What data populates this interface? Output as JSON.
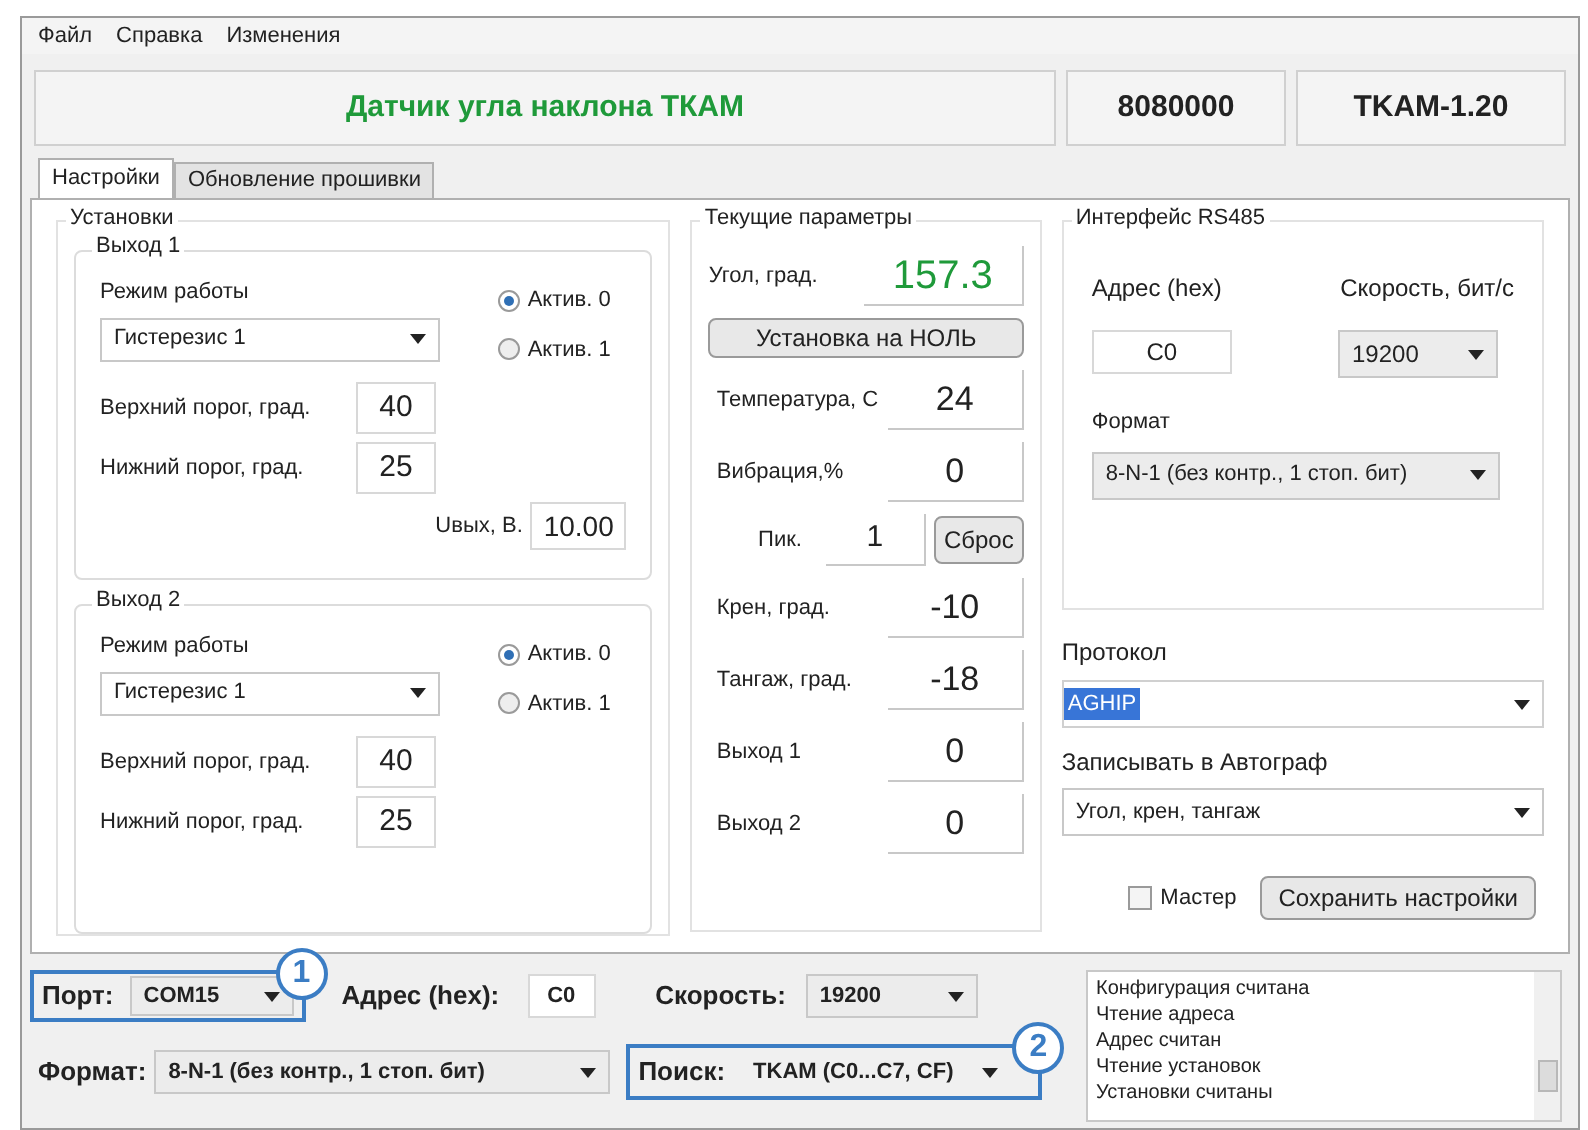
{
  "menu": [
    {
      "label": "Файл"
    },
    {
      "label": "Справка"
    },
    {
      "label": "Изменения"
    }
  ],
  "header": {
    "title": "Датчик угла наклона ТКАМ",
    "serial": "8080000",
    "version": "TKAM-1.20"
  },
  "tabs": [
    {
      "label": "Настройки",
      "selected": true
    },
    {
      "label": "Обновление прошивки",
      "selected": false
    }
  ],
  "settings": {
    "title": "Установки",
    "outputs": [
      {
        "title": "Выход 1",
        "mode_label": "Режим работы",
        "mode_value": "Гистерезис 1",
        "radios": [
          {
            "label": "Актив. 0",
            "selected": true
          },
          {
            "label": "Актив. 1",
            "selected": false
          }
        ],
        "upper_label": "Верхний порог, град.",
        "upper_value": "40",
        "lower_label": "Нижний порог, град.",
        "lower_value": "25",
        "voltage_label": "Uвых, В.",
        "voltage_value": "10.00"
      },
      {
        "title": "Выход 2",
        "mode_label": "Режим работы",
        "mode_value": "Гистерезис 1",
        "radios": [
          {
            "label": "Актив. 0",
            "selected": true
          },
          {
            "label": "Актив. 1",
            "selected": false
          }
        ],
        "upper_label": "Верхний порог, град.",
        "upper_value": "40",
        "lower_label": "Нижний порог, град.",
        "lower_value": "25"
      }
    ]
  },
  "current": {
    "title": "Текущие параметры",
    "angle_label": "Угол, град.",
    "angle_value": "157.3",
    "zero_button": "Установка на НОЛЬ",
    "readings": [
      {
        "kind": "value",
        "label": "Температура, С",
        "value": "24"
      },
      {
        "kind": "value",
        "label": "Вибрация,%",
        "value": "0"
      },
      {
        "kind": "peak",
        "label": "Пик.",
        "value": "1",
        "button": "Сброс"
      },
      {
        "kind": "value",
        "label": "Крен, град.",
        "value": "-10"
      },
      {
        "kind": "value",
        "label": "Тангаж, град.",
        "value": "-18"
      },
      {
        "kind": "value",
        "label": "Выход 1",
        "value": "0"
      },
      {
        "kind": "value",
        "label": "Выход 2",
        "value": "0"
      }
    ]
  },
  "rs485": {
    "title": "Интерфейс RS485",
    "address_label": "Адрес (hex)",
    "address_value": "C0",
    "speed_label": "Скорость, бит/с",
    "speed_value": "19200",
    "format_label": "Формат",
    "format_value": "8-N-1 (без контр., 1 стоп. бит)"
  },
  "protocol": {
    "label": "Протокол",
    "value": "AGHIP"
  },
  "autograph": {
    "label": "Записывать в Автограф",
    "value": "Угол, крен, тангаж"
  },
  "master": {
    "label": "Мастер",
    "checked": false
  },
  "save_button": "Сохранить настройки",
  "bottom": {
    "port": {
      "label": "Порт:",
      "value": "COM15",
      "marker": "1"
    },
    "address": {
      "label": "Адрес (hex):",
      "value": "C0"
    },
    "speed": {
      "label": "Скорость:",
      "value": "19200"
    },
    "format": {
      "label": "Формат:",
      "value": "8-N-1 (без контр., 1 стоп. бит)"
    },
    "search": {
      "label": "Поиск:",
      "value": "TKAM (C0...C7, CF)",
      "marker": "2"
    }
  },
  "log": [
    "Конфигурация считана",
    "Чтение адреса",
    "Адрес считан",
    "Чтение установок",
    "Установки считаны"
  ]
}
